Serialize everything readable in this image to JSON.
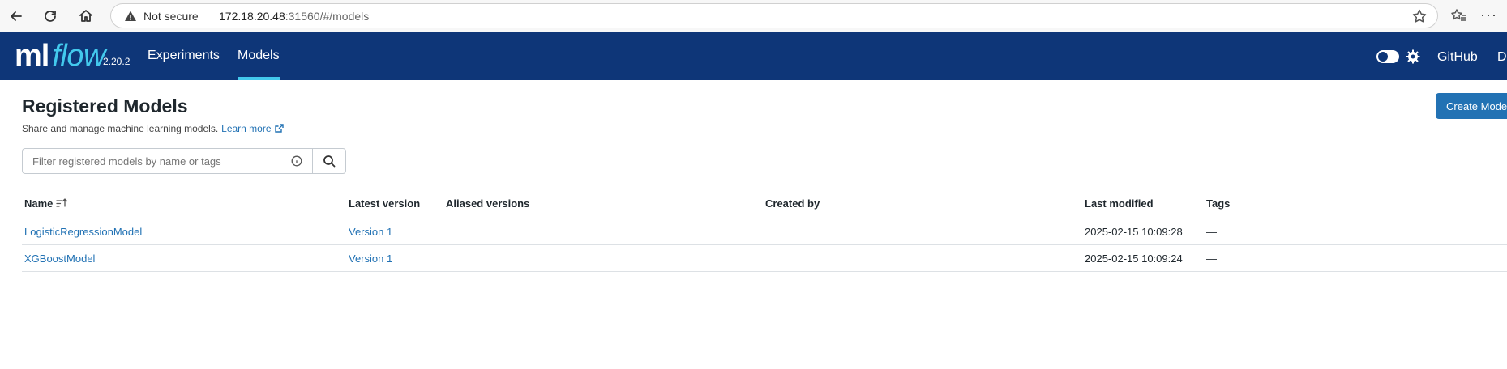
{
  "browser": {
    "not_secure": "Not secure",
    "url_host": "172.18.20.48",
    "url_rest": ":31560/#/models"
  },
  "header": {
    "logo_ml": "ml",
    "logo_flow": "flow",
    "version": "2.20.2",
    "nav": [
      {
        "label": "Experiments",
        "active": false
      },
      {
        "label": "Models",
        "active": true
      }
    ],
    "github": "GitHub",
    "docs": "D",
    "accent_color": "#43c9ed",
    "background_color": "#0e3678"
  },
  "page": {
    "title": "Registered Models",
    "subtitle": "Share and manage machine learning models.",
    "learn_more": "Learn more",
    "create_button": "Create Model",
    "search_placeholder": "Filter registered models by name or tags"
  },
  "table": {
    "columns": [
      "Name",
      "Latest version",
      "Aliased versions",
      "Created by",
      "Last modified",
      "Tags"
    ],
    "rows": [
      {
        "name": "LogisticRegressionModel",
        "latest_version": "Version 1",
        "aliased_versions": "",
        "created_by": "",
        "last_modified": "2025-02-15 10:09:28",
        "tags": "—"
      },
      {
        "name": "XGBoostModel",
        "latest_version": "Version 1",
        "aliased_versions": "",
        "created_by": "",
        "last_modified": "2025-02-15 10:09:24",
        "tags": "—"
      }
    ]
  }
}
